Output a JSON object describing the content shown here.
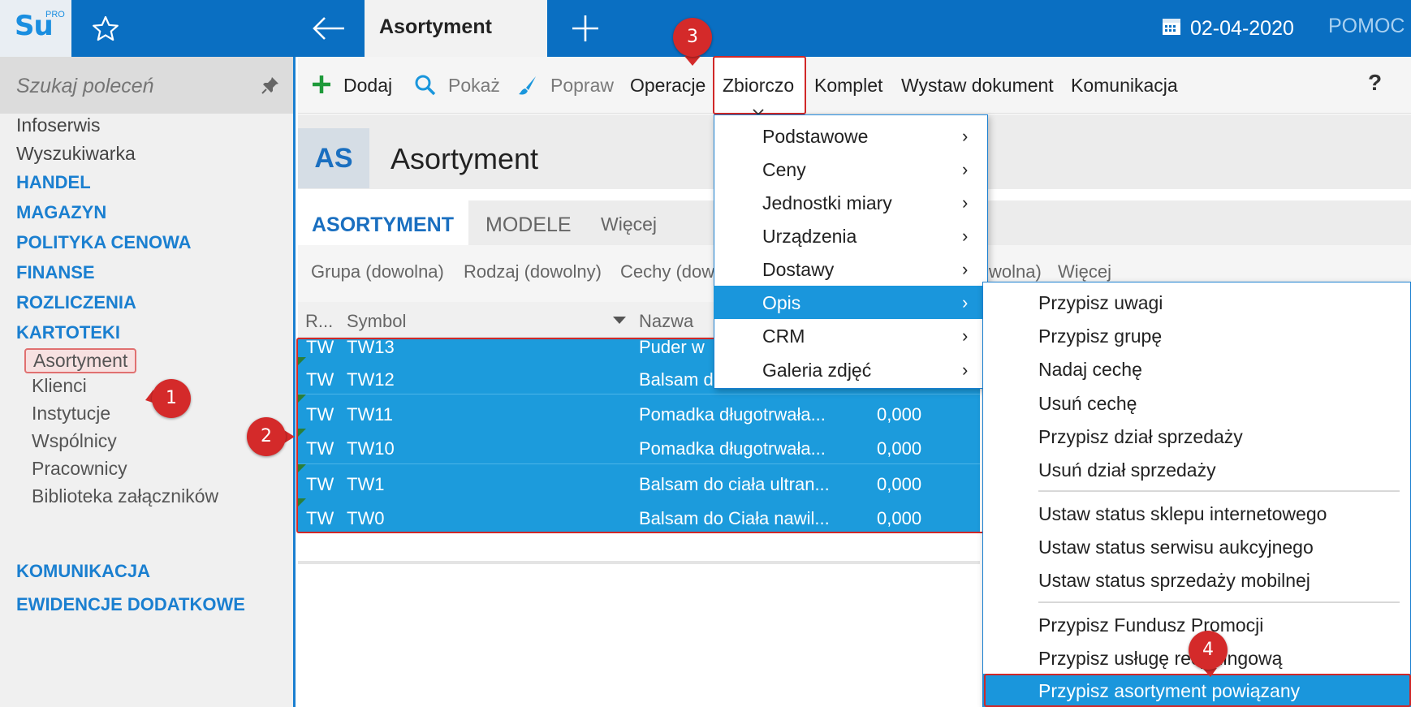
{
  "app": {
    "logo": "Su",
    "logo_sup": "PRO",
    "active_tab": "Asortyment",
    "date": "02-04-2020",
    "help": "POMOC"
  },
  "sidebar": {
    "search_placeholder": "Szukaj poleceń",
    "items": [
      {
        "label": "Infoserwis"
      },
      {
        "label": "Wyszukiwarka"
      }
    ],
    "sections": [
      "HANDEL",
      "MAGAZYN",
      "POLITYKA CENOWA",
      "FINANSE",
      "ROZLICZENIA",
      "KARTOTEKI",
      "KOMUNIKACJA",
      "EWIDENCJE DODATKOWE"
    ],
    "kartoteki": [
      "Asortyment",
      "Klienci",
      "Instytucje",
      "Wspólnicy",
      "Pracownicy",
      "Biblioteka załączników"
    ]
  },
  "toolbar": {
    "add": "Dodaj",
    "show": "Pokaż",
    "edit": "Popraw",
    "operations": "Operacje",
    "bulk": "Zbiorczo",
    "set": "Komplet",
    "issue_document": "Wystaw dokument",
    "communication": "Komunikacja",
    "help": "?"
  },
  "module": {
    "badge": "AS",
    "title": "Asortyment",
    "tabs": [
      "ASORTYMENT",
      "MODELE",
      "Więcej"
    ],
    "filters": [
      "Grupa (dowolna)",
      "Rodzaj (dowolny)",
      "Cechy (dow",
      "wolna)",
      "Więcej"
    ]
  },
  "grid": {
    "columns": [
      "R...",
      "Symbol",
      "Nazwa"
    ],
    "rows": [
      {
        "type": "TW",
        "symbol": "TW13",
        "name": "Puder w",
        "value": ""
      },
      {
        "type": "TW",
        "symbol": "TW12",
        "name": "Balsam d",
        "value": ""
      },
      {
        "type": "TW",
        "symbol": "TW11",
        "name": "Pomadka długotrwała...",
        "value": "0,000"
      },
      {
        "type": "TW",
        "symbol": "TW10",
        "name": "Pomadka długotrwała...",
        "value": "0,000"
      },
      {
        "type": "TW",
        "symbol": "TW1",
        "name": "Balsam do ciała ultran...",
        "value": "0,000"
      },
      {
        "type": "TW",
        "symbol": "TW0",
        "name": "Balsam do Ciała nawil...",
        "value": "0,000"
      }
    ]
  },
  "menu_bulk": {
    "items": [
      "Podstawowe",
      "Ceny",
      "Jednostki miary",
      "Urządzenia",
      "Dostawy",
      "Opis",
      "CRM",
      "Galeria zdjęć"
    ],
    "selected": "Opis"
  },
  "menu_opis": {
    "group1": [
      "Przypisz uwagi",
      "Przypisz grupę",
      "Nadaj cechę",
      "Usuń cechę",
      "Przypisz dział sprzedaży",
      "Usuń dział sprzedaży"
    ],
    "group2": [
      "Ustaw status sklepu internetowego",
      "Ustaw status serwisu aukcyjnego",
      "Ustaw status sprzedaży mobilnej"
    ],
    "group3": [
      "Przypisz Fundusz Promocji",
      "Przypisz usługę recyklingową"
    ],
    "selected": "Przypisz asortyment powiązany"
  },
  "callouts": [
    "1",
    "2",
    "3",
    "4"
  ],
  "colors": {
    "topbar": "#0a6fc2",
    "accent": "#1a7fd0",
    "selection": "#1c9bdc",
    "callout": "#d42a2a"
  }
}
